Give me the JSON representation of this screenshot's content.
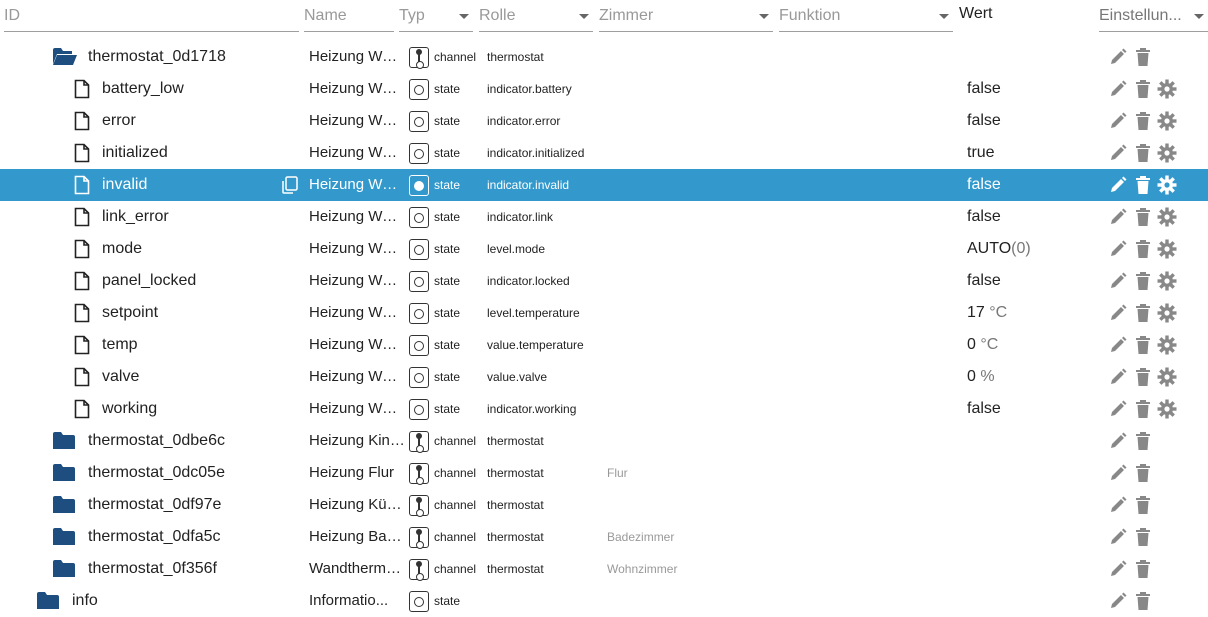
{
  "header": {
    "id_placeholder": "ID",
    "name_placeholder": "Name",
    "typ_label": "Typ",
    "rolle_label": "Rolle",
    "zimmer_label": "Zimmer",
    "funktion_label": "Funktion",
    "wert_label": "Wert",
    "einstellungen_label": "Einstellun..."
  },
  "colors": {
    "selected_bg": "#3399cc",
    "folder": "#1d4e7f",
    "action_icon": "#888888"
  },
  "rows": [
    {
      "id": "thermostat_0d1718",
      "kind": "folder-open",
      "name": "Heizung Woh...",
      "type": "channel",
      "role": "thermostat",
      "room": "",
      "value": "",
      "unit": ""
    },
    {
      "id": "battery_low",
      "kind": "file",
      "name": "Heizung Woh...",
      "type": "state",
      "role": "indicator.battery",
      "room": "",
      "value": "false",
      "unit": ""
    },
    {
      "id": "error",
      "kind": "file",
      "name": "Heizung Woh...",
      "type": "state",
      "role": "indicator.error",
      "room": "",
      "value": "false",
      "unit": ""
    },
    {
      "id": "initialized",
      "kind": "file",
      "name": "Heizung Woh...",
      "type": "state",
      "role": "indicator.initialized",
      "room": "",
      "value": "true",
      "unit": ""
    },
    {
      "id": "invalid",
      "kind": "file",
      "name": "Heizung Woh...",
      "type": "state",
      "role": "indicator.invalid",
      "room": "",
      "value": "false",
      "unit": "",
      "selected": true
    },
    {
      "id": "link_error",
      "kind": "file",
      "name": "Heizung Woh...",
      "type": "state",
      "role": "indicator.link",
      "room": "",
      "value": "false",
      "unit": ""
    },
    {
      "id": "mode",
      "kind": "file",
      "name": "Heizung Woh...",
      "type": "state",
      "role": "level.mode",
      "room": "",
      "value": "AUTO",
      "unit": "(0)"
    },
    {
      "id": "panel_locked",
      "kind": "file",
      "name": "Heizung Woh...",
      "type": "state",
      "role": "indicator.locked",
      "room": "",
      "value": "false",
      "unit": ""
    },
    {
      "id": "setpoint",
      "kind": "file",
      "name": "Heizung Woh...",
      "type": "state",
      "role": "level.temperature",
      "room": "",
      "value": "17",
      "unit": " °C"
    },
    {
      "id": "temp",
      "kind": "file",
      "name": "Heizung Woh...",
      "type": "state",
      "role": "value.temperature",
      "room": "",
      "value": "0",
      "unit": " °C"
    },
    {
      "id": "valve",
      "kind": "file",
      "name": "Heizung Woh...",
      "type": "state",
      "role": "value.valve",
      "room": "",
      "value": "0",
      "unit": " %"
    },
    {
      "id": "working",
      "kind": "file",
      "name": "Heizung Woh...",
      "type": "state",
      "role": "indicator.working",
      "room": "",
      "value": "false",
      "unit": ""
    },
    {
      "id": "thermostat_0dbe6c",
      "kind": "folder",
      "name": "Heizung Kind...",
      "type": "channel",
      "role": "thermostat",
      "room": "",
      "value": "",
      "unit": ""
    },
    {
      "id": "thermostat_0dc05e",
      "kind": "folder",
      "name": "Heizung Flur",
      "type": "channel",
      "role": "thermostat",
      "room": "Flur",
      "value": "",
      "unit": ""
    },
    {
      "id": "thermostat_0df97e",
      "kind": "folder",
      "name": "Heizung Küche",
      "type": "channel",
      "role": "thermostat",
      "room": "",
      "value": "",
      "unit": ""
    },
    {
      "id": "thermostat_0dfa5c",
      "kind": "folder",
      "name": "Heizung Bade...",
      "type": "channel",
      "role": "thermostat",
      "room": "Badezimmer",
      "value": "",
      "unit": ""
    },
    {
      "id": "thermostat_0f356f",
      "kind": "folder",
      "name": "Wandthermos...",
      "type": "channel",
      "role": "thermostat",
      "room": "Wohnzimmer",
      "value": "",
      "unit": ""
    },
    {
      "id": "info",
      "kind": "folder",
      "name": "Informatio...",
      "type": "state",
      "role": "",
      "room": "",
      "value": "",
      "unit": ""
    }
  ]
}
